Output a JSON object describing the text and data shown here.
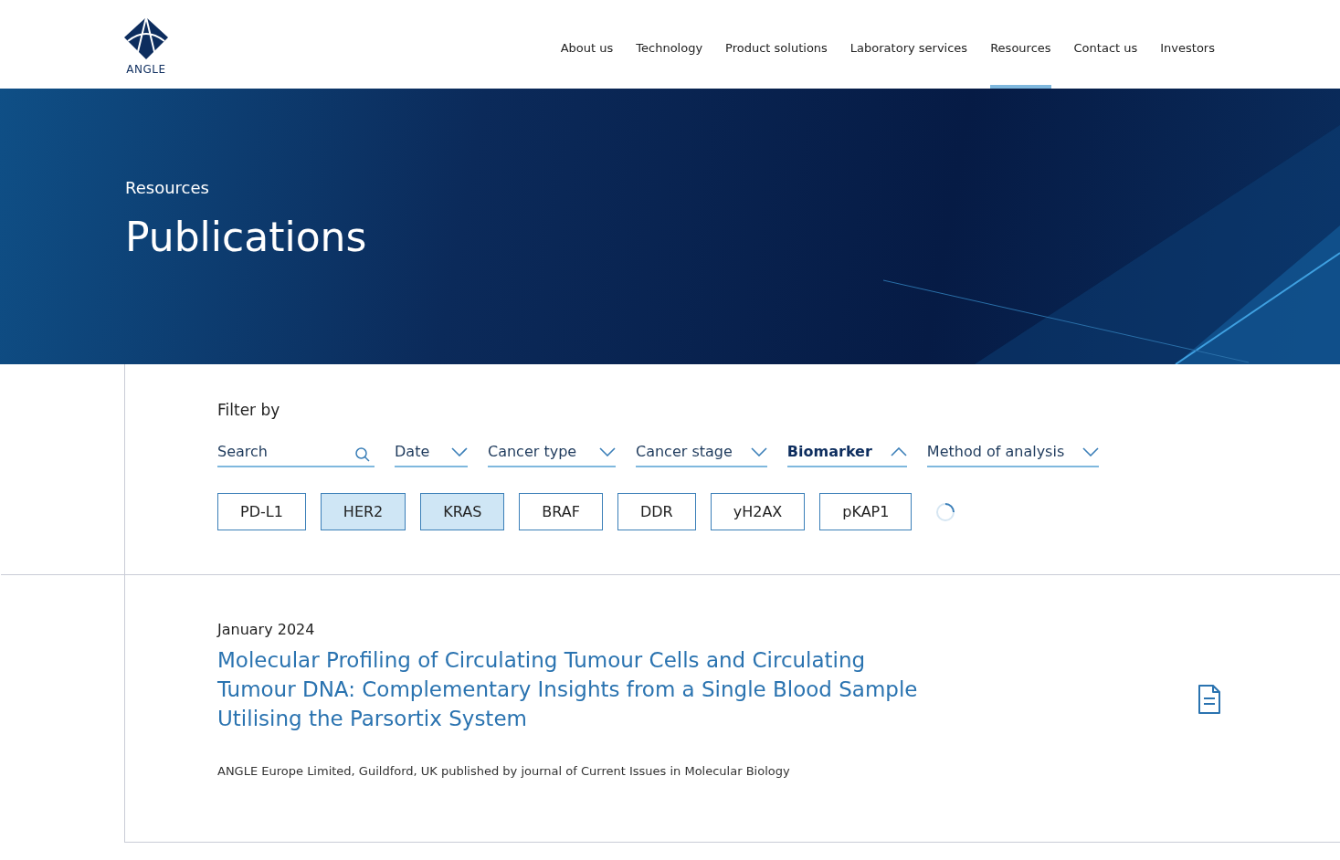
{
  "header": {
    "logo_text": "ANGLE",
    "nav": [
      {
        "label": "About us",
        "selected": false
      },
      {
        "label": "Technology",
        "selected": false
      },
      {
        "label": "Product solutions",
        "selected": false
      },
      {
        "label": "Laboratory services",
        "selected": false
      },
      {
        "label": "Resources",
        "selected": true
      },
      {
        "label": "Contact us",
        "selected": false
      },
      {
        "label": "Investors",
        "selected": false
      }
    ]
  },
  "hero": {
    "eyebrow": "Resources",
    "title": "Publications"
  },
  "filters": {
    "label": "Filter by",
    "controls": [
      {
        "kind": "search",
        "placeholder": "Search"
      },
      {
        "kind": "dropdown",
        "label": "Date",
        "expanded": false
      },
      {
        "kind": "dropdown",
        "label": "Cancer type",
        "expanded": false
      },
      {
        "kind": "dropdown",
        "label": "Cancer stage",
        "expanded": false
      },
      {
        "kind": "dropdown",
        "label": "Biomarker",
        "expanded": true
      },
      {
        "kind": "dropdown",
        "label": "Method of analysis",
        "expanded": false
      }
    ],
    "chips": [
      {
        "label": "PD-L1",
        "selected": false
      },
      {
        "label": "HER2",
        "selected": true
      },
      {
        "label": "KRAS",
        "selected": true
      },
      {
        "label": "BRAF",
        "selected": false
      },
      {
        "label": "DDR",
        "selected": false
      },
      {
        "label": "yH2AX",
        "selected": false
      },
      {
        "label": "pKAP1",
        "selected": false
      }
    ],
    "loading": true
  },
  "publications": [
    {
      "date": "January 2024",
      "title": "Molecular Profiling of Circulating Tumour Cells and Circulating Tumour DNA: Complementary Insights from a Single Blood Sample Utilising the Parsortix System",
      "source": "ANGLE Europe Limited, Guildford, UK published by journal of Current Issues in Molecular Biology"
    }
  ]
}
